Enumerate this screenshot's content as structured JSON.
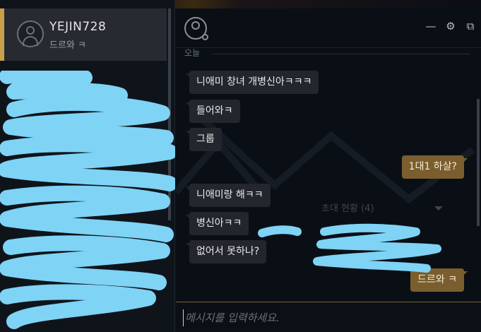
{
  "profile": {
    "username": "YEJIN728",
    "status": "드르와 ㅋ"
  },
  "chat": {
    "date_separator": "오늘",
    "invite_status": "초대 현황 (4)",
    "messages": [
      {
        "dir": "in",
        "text": "니애미 창녀 개병신아ㅋㅋㅋ"
      },
      {
        "dir": "in",
        "text": "들어와ㅋ"
      },
      {
        "dir": "in",
        "text": "그룹"
      },
      {
        "dir": "out",
        "text": "1대1 하살?"
      },
      {
        "dir": "in",
        "text": "니애미랑 해ㅋㅋ"
      },
      {
        "dir": "in",
        "text": "병신아ㅋㅋ"
      },
      {
        "dir": "in",
        "text": "없어서 못하나?"
      },
      {
        "dir": "out",
        "text": "드르와 ㅋ"
      }
    ],
    "input_placeholder": "메시지를 입력하세요.",
    "window_controls": {
      "minimize": "—",
      "settings": "⚙",
      "popout": "⧉"
    }
  },
  "colors": {
    "accent_gold": "#c8a04a",
    "outgoing_bubble": "#7a5e2e",
    "incoming_bubble": "#23272d",
    "redaction_scribble": "#7fd3f5"
  }
}
